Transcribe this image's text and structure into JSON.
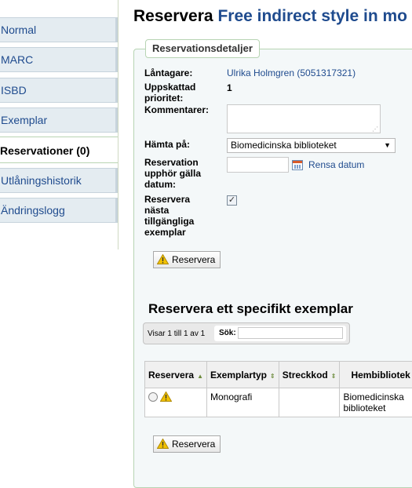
{
  "sidebar": {
    "items": [
      {
        "label": "Normal"
      },
      {
        "label": "MARC"
      },
      {
        "label": "ISBD"
      },
      {
        "label": "Exemplar"
      },
      {
        "label": "Reservationer (0)"
      },
      {
        "label": "Utlåningshistorik"
      },
      {
        "label": "Ändringslogg"
      }
    ]
  },
  "header": {
    "prefix": "Reservera",
    "bib_title": "Free indirect style in mo"
  },
  "details": {
    "legend": "Reservationsdetaljer",
    "borrower_label": "Låntagare:",
    "borrower_value": "Ulrika Holmgren (5051317321)",
    "priority_label": "Uppskattad prioritet:",
    "priority_value": "1",
    "comments_label": "Kommentarer:",
    "comments_value": "",
    "pickup_label": "Hämta på:",
    "pickup_value": "Biomedicinska biblioteket",
    "expiry_label": "Reservation upphör gälla datum:",
    "expiry_value": "",
    "clear_date": "Rensa datum",
    "next_available_label": "Reservera nästa tillgängliga exemplar",
    "next_available_checked": true,
    "submit_label": "Reservera"
  },
  "specific": {
    "title": "Reservera ett specifikt exemplar",
    "info": "Visar 1 till 1 av 1",
    "search_label": "Sök:",
    "search_value": "",
    "columns": [
      "Reservera",
      "Exemplartyp",
      "Streckkod",
      "Hembibliotek"
    ],
    "rows": [
      {
        "itemtype": "Monografi",
        "barcode": "",
        "homebranch": "Biomedicinska biblioteket"
      }
    ],
    "submit_label": "Reservera"
  },
  "colors": {
    "link": "#1f4b8e",
    "tab_bg": "#e4ecf1",
    "fieldset_border": "#b7d4b3",
    "warning": "#f2c200"
  },
  "icons": [
    "warning-icon",
    "calendar-icon",
    "sort-icon",
    "checkbox-checked"
  ]
}
